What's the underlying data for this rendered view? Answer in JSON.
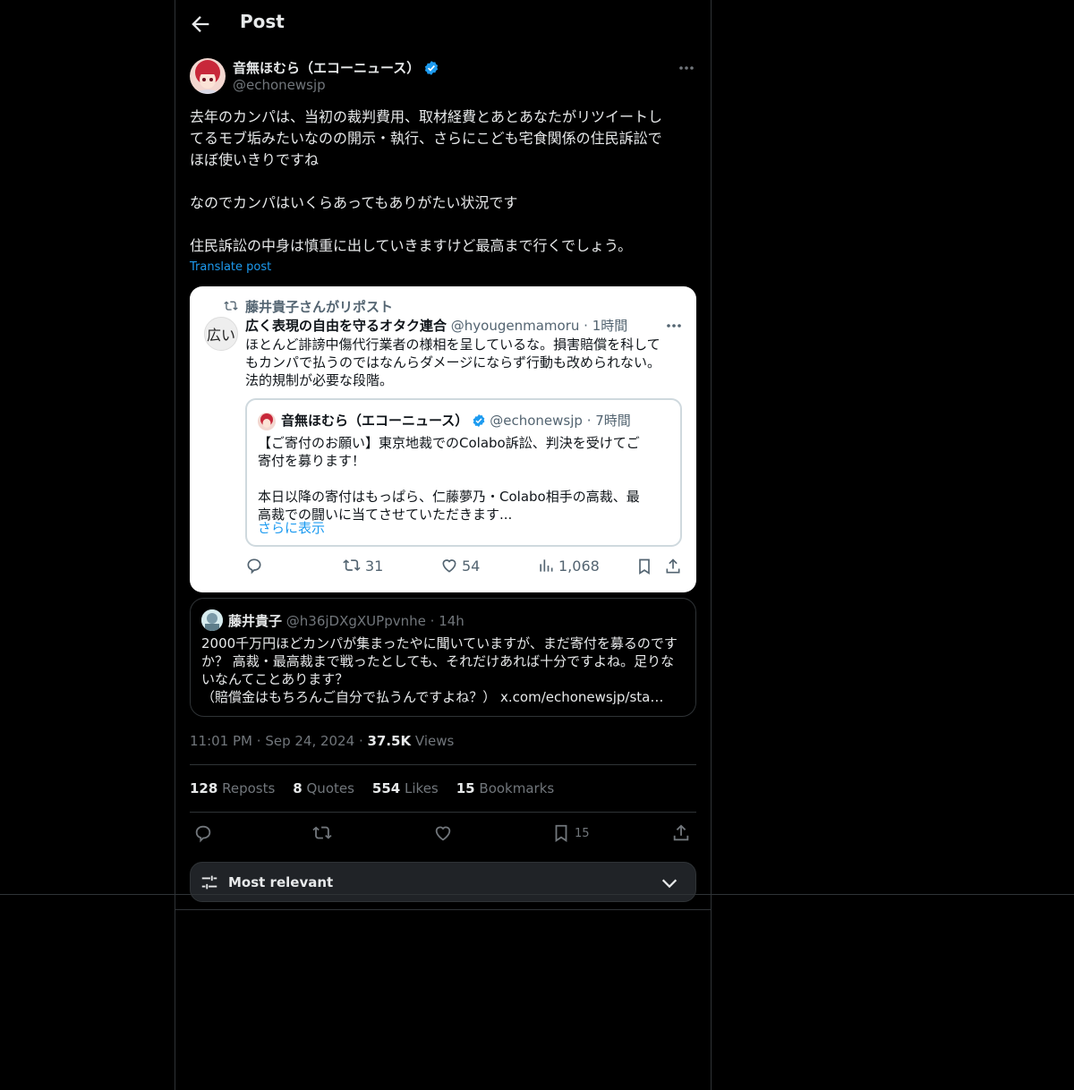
{
  "header": {
    "title": "Post"
  },
  "author": {
    "name": "音無ほむら（エコーニュース）",
    "handle": "@echonewsjp"
  },
  "post": {
    "text": "去年のカンパは、当初の裁判費用、取材経費とあとあなたがリツイートし\nてるモブ垢みたいなのの開示・執行、さらにこども宅食関係の住民訴訟で\nほぼ使いきりですね\n\nなのでカンパはいくらあってもありがたい状況です\n\n住民訴訟の中身は慎重に出していきますけど最高まで行くでしょう。",
    "translate": "Translate post"
  },
  "embedded_image": {
    "repost_label": "藤井貴子さんがリポスト",
    "avatar_text": "広い",
    "q_name": "広く表現の自由を守るオタク連合",
    "q_handle": "@hyougenmamoru · 1時間",
    "q_text": "ほとんど誹謗中傷代行業者の様相を呈しているな。損害賠償を科して\nもカンパで払うのではなんらダメージにならず行動も改められない。\n法的規制が必要な段階。",
    "inner_name": "音無ほむら（エコーニュース）",
    "inner_handle": "@echonewsjp · 7時間",
    "inner_text": "【ご寄付のお願い】東京地裁でのColabo訴訟、判決を受けてご\n寄付を募ります！\n\n本日以降の寄付はもっぱら、仁藤夢乃・Colabo相手の高裁、最\n高裁での闘いに当てさせていただきます...",
    "inner_more": "さらに表示",
    "retweets": "31",
    "likes": "54",
    "views": "1,068"
  },
  "quote": {
    "name": "藤井貴子",
    "handle": "@h36jDXgXUPpvnhe",
    "time": "14h",
    "text": "2000千万円ほどカンパが集まったやに聞いていますが、まだ寄付を募るのです\nか？ 高裁・最高裁まで戦ったとしても、それだけあれば十分ですよね。足りな\nいなんてことあります？\n（賠償金はもちろんご自分で払うんですよね？） x.com/echonewsjp/sta…"
  },
  "meta": {
    "time": "11:01 PM",
    "date": "Sep 24, 2024",
    "views_count": "37.5K",
    "views_label": "Views"
  },
  "stats": {
    "reposts_count": "128",
    "reposts_label": "Reposts",
    "quotes_count": "8",
    "quotes_label": "Quotes",
    "likes_count": "554",
    "likes_label": "Likes",
    "bookmarks_count": "15",
    "bookmarks_label": "Bookmarks"
  },
  "actions": {
    "bookmark_count": "15"
  },
  "sort": {
    "label": "Most relevant"
  },
  "colors": {
    "accent": "#1d9bf0",
    "verified": "#1d9bf0",
    "background": "#000000",
    "border": "#2f3336",
    "muted": "#71767b"
  }
}
